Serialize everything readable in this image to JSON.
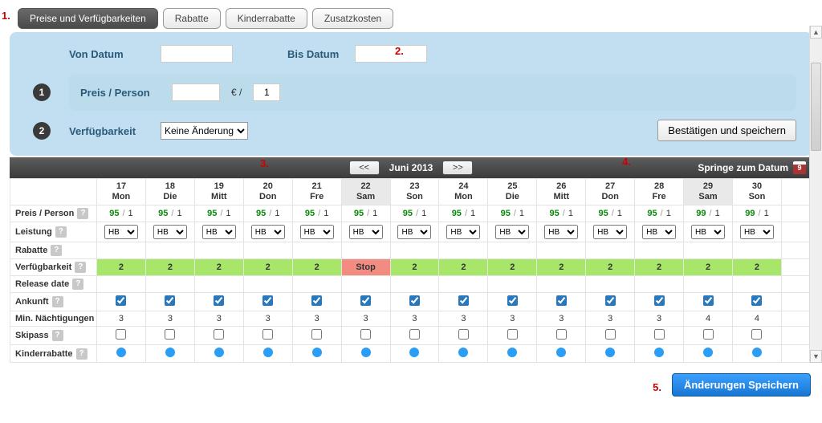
{
  "annotations": {
    "a1": "1.",
    "a2": "2.",
    "a3": "3.",
    "a4": "4.",
    "a5": "5."
  },
  "tabs": {
    "prices": "Preise und Verfügbarkeiten",
    "discounts": "Rabatte",
    "child": "Kinderrabatte",
    "extras": "Zusatzkosten"
  },
  "form": {
    "from_label": "Von Datum",
    "to_label": "Bis Datum",
    "price_label": "Preis / Person",
    "currency": "€ /",
    "occ_default": "1",
    "avail_label": "Verfügbarkeit",
    "avail_option": "Keine Änderung",
    "confirm": "Bestätigen und speichern"
  },
  "monthbar": {
    "prev": "<<",
    "title": "Juni 2013",
    "next": ">>",
    "jump": "Springe zum Datum",
    "cal_day": "9"
  },
  "rowlabels": {
    "price": "Preis / Person",
    "service": "Leistung",
    "discounts": "Rabatte",
    "avail": "Verfügbarkeit",
    "release": "Release date",
    "arrival": "Ankunft",
    "minstay": "Min. Nächtigungen",
    "skipass": "Skipass",
    "child": "Kinderrabatte"
  },
  "days": [
    {
      "num": "17",
      "dow": "Mon",
      "wknd": false
    },
    {
      "num": "18",
      "dow": "Die",
      "wknd": false
    },
    {
      "num": "19",
      "dow": "Mitt",
      "wknd": false
    },
    {
      "num": "20",
      "dow": "Don",
      "wknd": false
    },
    {
      "num": "21",
      "dow": "Fre",
      "wknd": false
    },
    {
      "num": "22",
      "dow": "Sam",
      "wknd": true
    },
    {
      "num": "23",
      "dow": "Son",
      "wknd": false
    },
    {
      "num": "24",
      "dow": "Mon",
      "wknd": false
    },
    {
      "num": "25",
      "dow": "Die",
      "wknd": false
    },
    {
      "num": "26",
      "dow": "Mitt",
      "wknd": false
    },
    {
      "num": "27",
      "dow": "Don",
      "wknd": false
    },
    {
      "num": "28",
      "dow": "Fre",
      "wknd": false
    },
    {
      "num": "29",
      "dow": "Sam",
      "wknd": true
    },
    {
      "num": "30",
      "dow": "Son",
      "wknd": false
    }
  ],
  "price_row": [
    {
      "p": "95",
      "o": "1"
    },
    {
      "p": "95",
      "o": "1"
    },
    {
      "p": "95",
      "o": "1"
    },
    {
      "p": "95",
      "o": "1"
    },
    {
      "p": "95",
      "o": "1"
    },
    {
      "p": "95",
      "o": "1"
    },
    {
      "p": "95",
      "o": "1"
    },
    {
      "p": "95",
      "o": "1"
    },
    {
      "p": "95",
      "o": "1"
    },
    {
      "p": "95",
      "o": "1"
    },
    {
      "p": "95",
      "o": "1"
    },
    {
      "p": "95",
      "o": "1"
    },
    {
      "p": "99",
      "o": "1"
    },
    {
      "p": "99",
      "o": "1"
    }
  ],
  "service_row": [
    "HB",
    "HB",
    "HB",
    "HB",
    "HB",
    "HB",
    "HB",
    "HB",
    "HB",
    "HB",
    "HB",
    "HB",
    "HB",
    "HB"
  ],
  "avail_row": [
    "2",
    "2",
    "2",
    "2",
    "2",
    "Stop",
    "2",
    "2",
    "2",
    "2",
    "2",
    "2",
    "2",
    "2"
  ],
  "arrival_row": [
    true,
    true,
    true,
    true,
    true,
    true,
    true,
    true,
    true,
    true,
    true,
    true,
    true,
    true
  ],
  "minstay_row": [
    "3",
    "3",
    "3",
    "3",
    "3",
    "3",
    "3",
    "3",
    "3",
    "3",
    "3",
    "3",
    "4",
    "4"
  ],
  "skipass_row": [
    false,
    false,
    false,
    false,
    false,
    false,
    false,
    false,
    false,
    false,
    false,
    false,
    false,
    false
  ],
  "child_row": [
    true,
    true,
    true,
    true,
    true,
    true,
    true,
    true,
    true,
    true,
    true,
    true,
    true,
    true
  ],
  "footer": {
    "save": "Änderungen Speichern"
  },
  "hint": "?"
}
